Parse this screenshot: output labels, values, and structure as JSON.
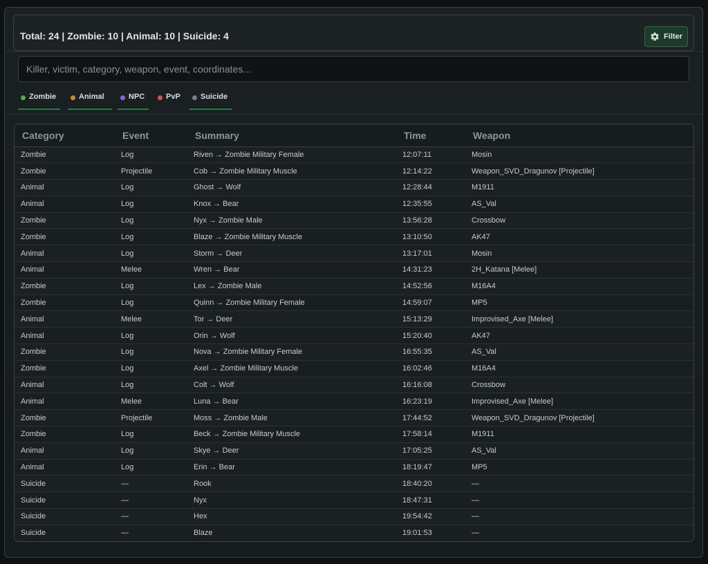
{
  "header": {
    "title": "Total: 24 | Zombie: 10 | Animal: 10 | Suicide: 4",
    "filter_label": "Filter"
  },
  "search": {
    "placeholder": "Killer, victim, category, weapon, event, coordinates...",
    "value": ""
  },
  "chips": [
    {
      "label": "Zombie",
      "color": "#4caf50"
    },
    {
      "label": "Animal",
      "color": "#c8872e"
    },
    {
      "label": "NPC",
      "color": "#7e6ad6"
    },
    {
      "label": "PvP",
      "color": "#d9534f"
    },
    {
      "label": "Suicide",
      "color": "#7a7f84"
    }
  ],
  "table": {
    "columns": [
      "Category",
      "Event",
      "Summary",
      "Time",
      "Weapon"
    ],
    "rows": [
      [
        "Zombie",
        "Log",
        "Riven → Zombie Military Female",
        "12:07:11",
        "Mosin"
      ],
      [
        "Zombie",
        "Projectile",
        "Cob → Zombie Military Muscle",
        "12:14:22",
        "Weapon_SVD_Dragunov [Projectile]"
      ],
      [
        "Animal",
        "Log",
        "Ghost → Wolf",
        "12:28:44",
        "M1911"
      ],
      [
        "Animal",
        "Log",
        "Knox → Bear",
        "12:35:55",
        "AS_Val"
      ],
      [
        "Zombie",
        "Log",
        "Nyx → Zombie Male",
        "13:56:28",
        "Crossbow"
      ],
      [
        "Zombie",
        "Log",
        "Blaze → Zombie Military Muscle",
        "13:10:50",
        "AK47"
      ],
      [
        "Animal",
        "Log",
        "Storm → Deer",
        "13:17:01",
        "Mosin"
      ],
      [
        "Animal",
        "Melee",
        "Wren → Bear",
        "14:31:23",
        "2H_Katana [Melee]"
      ],
      [
        "Zombie",
        "Log",
        "Lex → Zombie Male",
        "14:52:56",
        "M16A4"
      ],
      [
        "Zombie",
        "Log",
        "Quinn → Zombie Military Female",
        "14:59:07",
        "MP5"
      ],
      [
        "Animal",
        "Melee",
        "Tor → Deer",
        "15:13:29",
        "Improvised_Axe [Melee]"
      ],
      [
        "Animal",
        "Log",
        "Orin → Wolf",
        "15:20:40",
        "AK47"
      ],
      [
        "Zombie",
        "Log",
        "Nova → Zombie Military Female",
        "16:55:35",
        "AS_Val"
      ],
      [
        "Zombie",
        "Log",
        "Axel → Zombie Military Muscle",
        "16:02:46",
        "M16A4"
      ],
      [
        "Animal",
        "Log",
        "Colt → Wolf",
        "16:16:08",
        "Crossbow"
      ],
      [
        "Animal",
        "Melee",
        "Luna → Bear",
        "16:23:19",
        "Improvised_Axe [Melee]"
      ],
      [
        "Zombie",
        "Projectile",
        "Moss → Zombie Male",
        "17:44:52",
        "Weapon_SVD_Dragunov [Projectile]"
      ],
      [
        "Zombie",
        "Log",
        "Beck → Zombie Military Muscle",
        "17:58:14",
        "M1911"
      ],
      [
        "Animal",
        "Log",
        "Skye → Deer",
        "17:05:25",
        "AS_Val"
      ],
      [
        "Animal",
        "Log",
        "Erin → Bear",
        "18:19:47",
        "MP5"
      ],
      [
        "Suicide",
        "—",
        "Rook",
        "18:40:20",
        "—"
      ],
      [
        "Suicide",
        "—",
        "Nyx",
        "18:47:31",
        "—"
      ],
      [
        "Suicide",
        "—",
        "Hex",
        "19:54:42",
        "—"
      ],
      [
        "Suicide",
        "—",
        "Blaze",
        "19:01:53",
        "—"
      ]
    ]
  },
  "colors": {
    "accent": "#2a7a4a",
    "background": "#0d1214"
  }
}
